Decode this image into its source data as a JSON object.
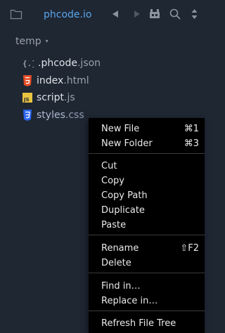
{
  "toolbar": {
    "project_title": "phcode.io",
    "icons": [
      "new-folder-icon",
      "nav-back-icon",
      "nav-forward-icon",
      "extensions-icon",
      "search-icon",
      "sort-icon"
    ]
  },
  "project": {
    "root_name": "temp",
    "root_caret": "▾"
  },
  "files": [
    {
      "base": ".phcode",
      "ext": ".json",
      "icon": "json-file-icon"
    },
    {
      "base": "index",
      "ext": ".html",
      "icon": "html5-file-icon"
    },
    {
      "base": "script",
      "ext": ".js",
      "icon": "javascript-file-icon"
    },
    {
      "base": "styles",
      "ext": ".css",
      "icon": "css3-file-icon"
    }
  ],
  "context_menu": {
    "new_file": {
      "label": "New File",
      "shortcut": "⌘1"
    },
    "new_folder": {
      "label": "New Folder",
      "shortcut": "⌘3"
    },
    "cut": {
      "label": "Cut"
    },
    "copy": {
      "label": "Copy"
    },
    "copy_path": {
      "label": "Copy Path"
    },
    "duplicate": {
      "label": "Duplicate"
    },
    "paste": {
      "label": "Paste"
    },
    "rename": {
      "label": "Rename",
      "shortcut": "⇧F2"
    },
    "delete": {
      "label": "Delete"
    },
    "find_in": {
      "label": "Find in…"
    },
    "replace_in": {
      "label": "Replace in…"
    },
    "refresh": {
      "label": "Refresh File Tree"
    }
  },
  "colors": {
    "background": "#1f2733",
    "accent": "#5aa6ee",
    "menu_background": "#000000",
    "html_icon": "#e44d26",
    "js_icon": "#e8c440",
    "css_icon": "#2965f1"
  }
}
